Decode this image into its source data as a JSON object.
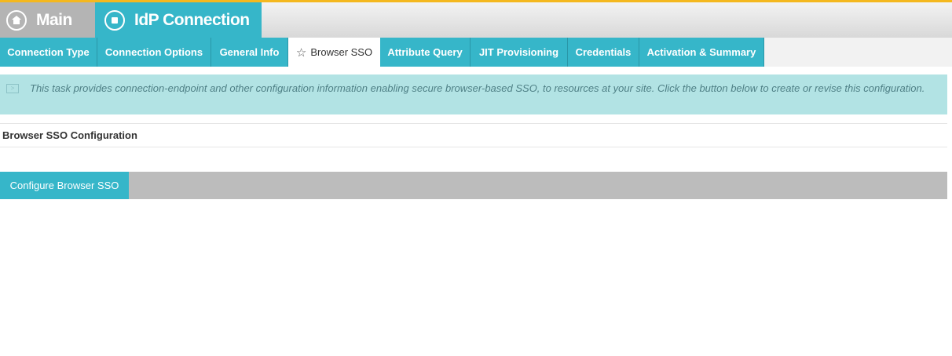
{
  "header": {
    "main_label": "Main",
    "main_icon": "home-icon",
    "connection_label": "IdP Connection",
    "connection_icon": "stop-icon"
  },
  "tabs": [
    {
      "label": "Connection Type",
      "active": false
    },
    {
      "label": "Connection Options",
      "active": false
    },
    {
      "label": "General Info",
      "active": false
    },
    {
      "label": "Browser SSO",
      "active": true,
      "icon": "star-icon"
    },
    {
      "label": "Attribute Query",
      "active": false
    },
    {
      "label": "JIT Provisioning",
      "active": false
    },
    {
      "label": "Credentials",
      "active": false
    },
    {
      "label": "Activation & Summary",
      "active": false
    }
  ],
  "info": {
    "text": "This task provides connection-endpoint and other configuration information enabling secure browser-based SSO, to resources at your site. Click the button below to create or revise this configuration.",
    "icon": "info-icon"
  },
  "section": {
    "title": "Browser SSO Configuration"
  },
  "actions": {
    "configure_label": "Configure Browser SSO"
  },
  "colors": {
    "accent": "#36b6c9",
    "top_bar": "#f4b81f",
    "inactive_header": "#b4b4b4",
    "info_bg": "#b2e3e4",
    "button_bar": "#bcbcbc"
  }
}
